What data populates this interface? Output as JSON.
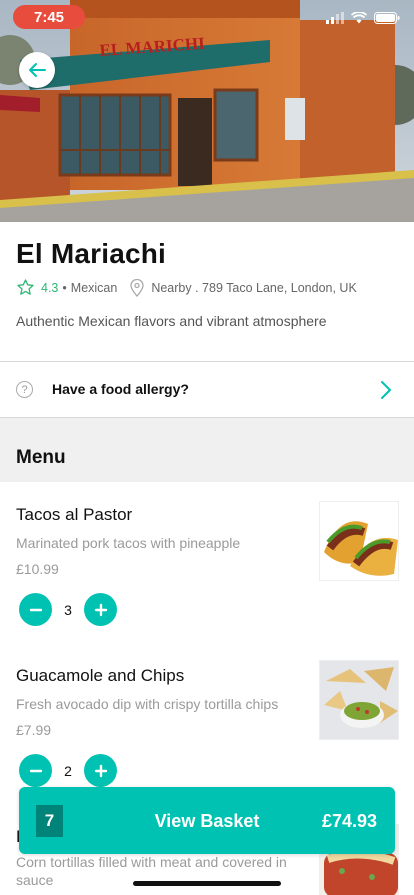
{
  "status": {
    "time": "7:45"
  },
  "restaurant": {
    "name": "El Mariachi",
    "rating": "4.3",
    "cuisine": "Mexican",
    "location": "Nearby . 789 Taco Lane, London, UK",
    "description": "Authentic Mexican flavors and vibrant atmosphere",
    "sign_text": "EL MARICHI"
  },
  "allergy": {
    "label": "Have a food allergy?"
  },
  "menu": {
    "title": "Menu",
    "items": [
      {
        "name": "Tacos al Pastor",
        "description": "Marinated pork tacos with pineapple",
        "price": "£10.99",
        "quantity": "3"
      },
      {
        "name": "Guacamole and Chips",
        "description": "Fresh avocado dip with crispy tortilla chips",
        "price": "£7.99",
        "quantity": "2"
      },
      {
        "name": "E",
        "description": "Corn tortillas filled with meat and covered in sauce"
      }
    ]
  },
  "basket": {
    "count": "7",
    "label": "View Basket",
    "total": "£74.93"
  },
  "colors": {
    "accent": "#00c2b2",
    "accent_dark": "#00847a",
    "rating": "#2bb673",
    "status_pill": "#e74c3c"
  }
}
